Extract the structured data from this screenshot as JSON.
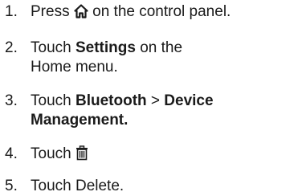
{
  "steps": [
    {
      "number": "1.",
      "before": "Press ",
      "icon": "home-icon",
      "after": " on the control panel."
    },
    {
      "number": "2.",
      "before": "Touch ",
      "bold": "Settings",
      "after_line1": " on the",
      "line2": "Home menu."
    },
    {
      "number": "3.",
      "before": "Touch ",
      "bold1": "Bluetooth",
      "separator": " > ",
      "bold2_line1": "Device",
      "bold2_line2": "Management",
      "after": "."
    },
    {
      "number": "4.",
      "before": "Touch ",
      "icon": "trash-icon"
    },
    {
      "number": "5.",
      "text": "Touch Delete."
    }
  ]
}
